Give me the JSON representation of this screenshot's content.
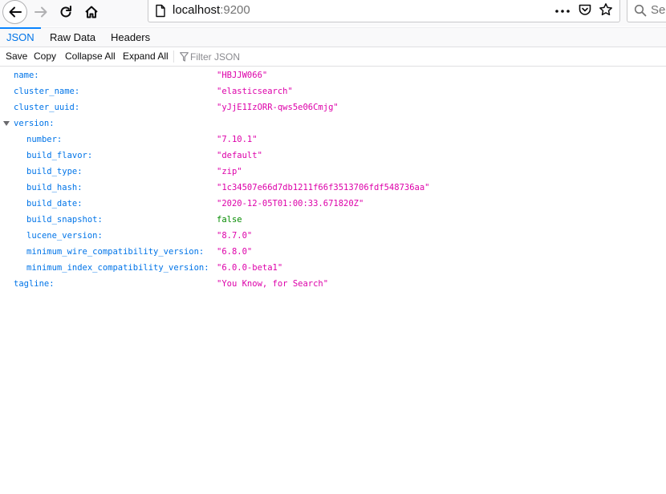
{
  "browser": {
    "url_host": "localhost",
    "url_port": ":9200",
    "search_placeholder": "Search"
  },
  "tabs": [
    {
      "label": "JSON",
      "selected": true
    },
    {
      "label": "Raw Data",
      "selected": false
    },
    {
      "label": "Headers",
      "selected": false
    }
  ],
  "toolbar": {
    "save": "Save",
    "copy": "Copy",
    "collapse_all": "Collapse All",
    "expand_all": "Expand All",
    "filter_placeholder": "Filter JSON"
  },
  "json_rows": [
    {
      "key": "name:",
      "value": "\"HBJJW066\"",
      "type": "string",
      "level": 0
    },
    {
      "key": "cluster_name:",
      "value": "\"elasticsearch\"",
      "type": "string",
      "level": 0
    },
    {
      "key": "cluster_uuid:",
      "value": "\"yJjE1IzORR-qws5e06Cmjg\"",
      "type": "string",
      "level": 0
    },
    {
      "key": "version:",
      "value": "",
      "type": "object",
      "level": 0,
      "expanded": true
    },
    {
      "key": "number:",
      "value": "\"7.10.1\"",
      "type": "string",
      "level": 1
    },
    {
      "key": "build_flavor:",
      "value": "\"default\"",
      "type": "string",
      "level": 1
    },
    {
      "key": "build_type:",
      "value": "\"zip\"",
      "type": "string",
      "level": 1
    },
    {
      "key": "build_hash:",
      "value": "\"1c34507e66d7db1211f66f3513706fdf548736aa\"",
      "type": "string",
      "level": 1
    },
    {
      "key": "build_date:",
      "value": "\"2020-12-05T01:00:33.671820Z\"",
      "type": "string",
      "level": 1
    },
    {
      "key": "build_snapshot:",
      "value": "false",
      "type": "bool",
      "level": 1
    },
    {
      "key": "lucene_version:",
      "value": "\"8.7.0\"",
      "type": "string",
      "level": 1
    },
    {
      "key": "minimum_wire_compatibility_version:",
      "value": "\"6.8.0\"",
      "type": "string",
      "level": 1
    },
    {
      "key": "minimum_index_compatibility_version:",
      "value": "\"6.0.0-beta1\"",
      "type": "string",
      "level": 1
    },
    {
      "key": "tagline:",
      "value": "\"You Know, for Search\"",
      "type": "string",
      "level": 0
    }
  ],
  "colors": {
    "key": "#0074e8",
    "string": "#dd00a9",
    "bool": "#058b00",
    "tab_selected": "#0a84ff"
  },
  "icons": [
    "back-arrow-icon",
    "forward-arrow-icon",
    "reload-icon",
    "home-icon",
    "page-info-icon",
    "page-actions-icon",
    "pocket-icon",
    "bookmark-star-icon",
    "search-icon",
    "filter-icon",
    "expand-twisty-icon"
  ]
}
